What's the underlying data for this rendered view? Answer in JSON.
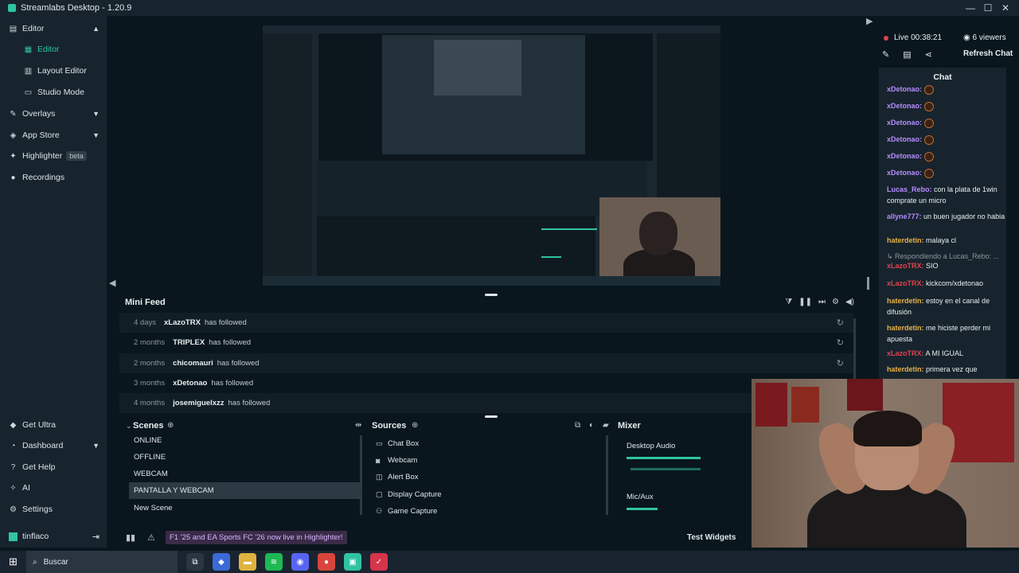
{
  "window": {
    "title": "Streamlabs Desktop - 1.20.9",
    "controls": [
      "—",
      "☐",
      "✕"
    ]
  },
  "sidebar": {
    "items": [
      {
        "label": "Editor",
        "icon": "editor-icon"
      },
      {
        "label": "Editor",
        "icon": "grid-icon"
      },
      {
        "label": "Layout Editor",
        "icon": "layout-icon"
      },
      {
        "label": "Studio Mode",
        "icon": "studio-icon"
      },
      {
        "label": "Overlays",
        "icon": "brush-icon"
      },
      {
        "label": "App Store",
        "icon": "store-icon"
      },
      {
        "label": "Highlighter",
        "icon": "highlighter-icon"
      },
      {
        "label": "Recordings",
        "icon": "record-icon"
      }
    ],
    "beta_badge": "beta",
    "bottom_items": [
      {
        "label": "Get Ultra"
      },
      {
        "label": "Dashboard"
      },
      {
        "label": "Get Help"
      },
      {
        "label": "AI"
      },
      {
        "label": "Settings"
      }
    ],
    "user": "tinflaco"
  },
  "minifeed": {
    "title": "Mini Feed",
    "rows": [
      {
        "when": "4 days",
        "who": "xLazoTRX",
        "what": "has followed"
      },
      {
        "when": "2 months",
        "who": "TRIPLEX",
        "what": "has followed"
      },
      {
        "when": "2 months",
        "who": "chicomauri",
        "what": "has followed"
      },
      {
        "when": "3 months",
        "who": "xDetonao",
        "what": "has followed"
      },
      {
        "when": "4 months",
        "who": "josemiguelxzz",
        "what": "has followed"
      }
    ]
  },
  "scenes": {
    "title": "Scenes",
    "items": [
      "ONLINE",
      "OFFLINE",
      "WEBCAM",
      "PANTALLA Y WEBCAM",
      "New Scene"
    ],
    "selected": "PANTALLA Y WEBCAM"
  },
  "sources": {
    "title": "Sources",
    "items": [
      "Chat Box",
      "Webcam",
      "Alert Box",
      "Display Capture",
      "Game Capture"
    ]
  },
  "mixer": {
    "title": "Mixer",
    "channels": [
      {
        "label": "Desktop Audio",
        "level": 0.6
      },
      {
        "label": "Mic/Aux",
        "level": 0.25
      }
    ]
  },
  "status": {
    "promo": "F1 '25 and EA Sports FC '26 now live in Highlighter!",
    "test_widgets": "Test Widgets"
  },
  "right_panel": {
    "live_time": "Live 00:38:21",
    "viewers": "6 viewers",
    "refresh_chat": "Refresh Chat",
    "chat_title": "Chat",
    "messages": [
      {
        "user": "xDetonao:",
        "text": "",
        "emote": true,
        "color": "#b58cff"
      },
      {
        "user": "xDetonao:",
        "text": "",
        "emote": true,
        "color": "#b58cff"
      },
      {
        "user": "xDetonao:",
        "text": "",
        "emote": true,
        "color": "#b58cff"
      },
      {
        "user": "xDetonao:",
        "text": "",
        "emote": true,
        "color": "#b58cff"
      },
      {
        "user": "xDetonao:",
        "text": "",
        "emote": true,
        "color": "#b58cff"
      },
      {
        "user": "xDetonao:",
        "text": "",
        "emote": true,
        "color": "#b58cff"
      },
      {
        "user": "Lucas_Rebo:",
        "text": "con la plata de 1win comprate un micro",
        "emote": false,
        "color": "#b58cff"
      },
      {
        "user": "allyne777:",
        "text": "un buen jugador no habia",
        "emote": false,
        "color": "#b58cff"
      },
      {
        "user": "haterdetin:",
        "text": "malaya cl",
        "emote": false,
        "color": "#e7b14a"
      },
      {
        "user": "",
        "text": "Respondiendo a Lucas_Rebo: ...",
        "emote": false,
        "color": "#8c979c"
      },
      {
        "user": "xLazoTRX:",
        "text": "SIO",
        "emote": false,
        "color": "#e0424f"
      },
      {
        "user": "xLazoTRX:",
        "text": "kickcom/xdetonao",
        "emote": false,
        "color": "#e0424f"
      },
      {
        "user": "haterdetin:",
        "text": "estoy en el canal de difusión",
        "emote": false,
        "color": "#e7b14a"
      },
      {
        "user": "haterdetin:",
        "text": "me hiciste perder mi apuesta",
        "emote": false,
        "color": "#e7b14a"
      },
      {
        "user": "xLazoTRX:",
        "text": "A MI IGUAL",
        "emote": false,
        "color": "#e0424f"
      },
      {
        "user": "haterdetin:",
        "text": "primera vez que",
        "emote": false,
        "color": "#e7b14a"
      }
    ]
  },
  "taskbar": {
    "search_placeholder": "Buscar",
    "apps": [
      {
        "name": "task-view-icon",
        "color": "#2b3542",
        "glyph": "⧉"
      },
      {
        "name": "copilot-icon",
        "color": "#3a6ad6",
        "glyph": "◆"
      },
      {
        "name": "files-icon",
        "color": "#e0b340",
        "glyph": "▬"
      },
      {
        "name": "spotify-icon",
        "color": "#1db954",
        "glyph": "≋"
      },
      {
        "name": "discord-icon",
        "color": "#5865f2",
        "glyph": "◉"
      },
      {
        "name": "chrome-icon",
        "color": "#d9453c",
        "glyph": "●"
      },
      {
        "name": "streamlabs-icon",
        "color": "#31c3a2",
        "glyph": "▣"
      },
      {
        "name": "app-icon",
        "color": "#d6354a",
        "glyph": "✓"
      }
    ]
  },
  "colors": {
    "accent": "#31c3a2",
    "live": "#e0424f",
    "promo_text": "#d7b4ff"
  }
}
